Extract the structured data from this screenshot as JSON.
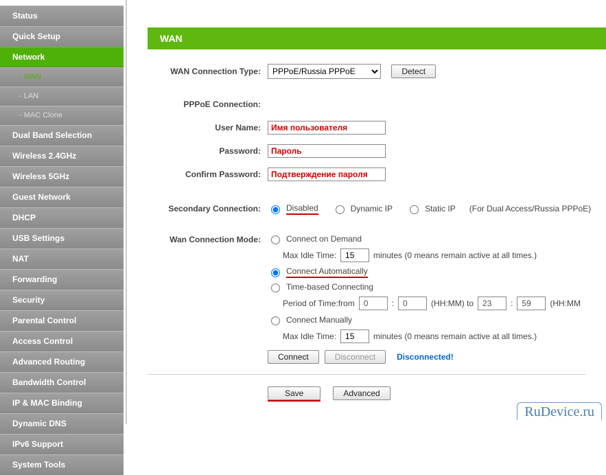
{
  "sidebar": {
    "items": [
      {
        "label": "Status",
        "type": "top"
      },
      {
        "label": "Quick Setup",
        "type": "top"
      },
      {
        "label": "Network",
        "type": "top",
        "active": true
      },
      {
        "label": "- WAN",
        "type": "sub",
        "active": true
      },
      {
        "label": "- LAN",
        "type": "sub"
      },
      {
        "label": "- MAC Clone",
        "type": "sub"
      },
      {
        "label": "Dual Band Selection",
        "type": "top"
      },
      {
        "label": "Wireless 2.4GHz",
        "type": "top"
      },
      {
        "label": "Wireless 5GHz",
        "type": "top"
      },
      {
        "label": "Guest Network",
        "type": "top"
      },
      {
        "label": "DHCP",
        "type": "top"
      },
      {
        "label": "USB Settings",
        "type": "top"
      },
      {
        "label": "NAT",
        "type": "top"
      },
      {
        "label": "Forwarding",
        "type": "top"
      },
      {
        "label": "Security",
        "type": "top"
      },
      {
        "label": "Parental Control",
        "type": "top"
      },
      {
        "label": "Access Control",
        "type": "top"
      },
      {
        "label": "Advanced Routing",
        "type": "top"
      },
      {
        "label": "Bandwidth Control",
        "type": "top"
      },
      {
        "label": "IP & MAC Binding",
        "type": "top"
      },
      {
        "label": "Dynamic DNS",
        "type": "top"
      },
      {
        "label": "IPv6 Support",
        "type": "top"
      },
      {
        "label": "System Tools",
        "type": "top"
      }
    ]
  },
  "header": {
    "title": "WAN"
  },
  "labels": {
    "wan_conn_type": "WAN Connection Type:",
    "pppoe_conn": "PPPoE Connection:",
    "username": "User Name:",
    "password": "Password:",
    "confirm_password": "Confirm Password:",
    "secondary_conn": "Secondary Connection:",
    "wan_conn_mode": "Wan Connection Mode:"
  },
  "wan_type": {
    "selected": "PPPoE/Russia PPPoE",
    "detect_btn": "Detect"
  },
  "pppoe": {
    "username_ph": "Имя пользователя",
    "password_ph": "Пароль",
    "confirm_ph": "Подтверждение пароля"
  },
  "secondary": {
    "disabled": "Disabled",
    "dynamic": "Dynamic IP",
    "static": "Static IP",
    "note": "(For Dual Access/Russia PPPoE)",
    "selected": "disabled"
  },
  "mode": {
    "demand": "Connect on Demand",
    "max_idle_label": "Max Idle Time:",
    "idle1": "15",
    "idle_unit": "minutes (0 means remain active at all times.)",
    "auto": "Connect Automatically",
    "time_based": "Time-based Connecting",
    "period_label": "Period of Time:from",
    "p_h1": "0",
    "p_m1": "0",
    "hhmm": "(HH:MM) to",
    "p_h2": "23",
    "p_m2": "59",
    "hhmm2": "(HH:MM",
    "manual": "Connect Manually",
    "idle2": "15",
    "selected": "auto"
  },
  "buttons": {
    "connect": "Connect",
    "disconnect": "Disconnect",
    "status": "Disconnected!",
    "save": "Save",
    "advanced": "Advanced"
  },
  "watermark": "RuDevice.ru"
}
